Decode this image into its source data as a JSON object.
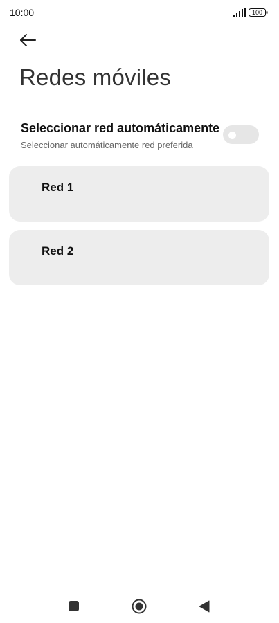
{
  "status_bar": {
    "time": "10:00",
    "battery": "100",
    "signal_icon": "signal-bars-icon",
    "battery_icon": "battery-icon"
  },
  "header": {
    "back_icon": "arrow-left-icon",
    "title": "Redes móviles"
  },
  "auto_select": {
    "title": "Seleccionar red automáticamente",
    "subtitle": "Seleccionar automáticamente red preferida",
    "enabled": false
  },
  "networks": [
    {
      "label": "Red 1"
    },
    {
      "label": "Red 2"
    }
  ],
  "nav_bar": {
    "recents_icon": "square-icon",
    "home_icon": "circle-icon",
    "back_icon": "triangle-back-icon"
  },
  "colors": {
    "card_background": "#ededed",
    "toggle_off": "#e6e6e6",
    "text_primary": "#111111",
    "text_secondary": "#666666"
  }
}
